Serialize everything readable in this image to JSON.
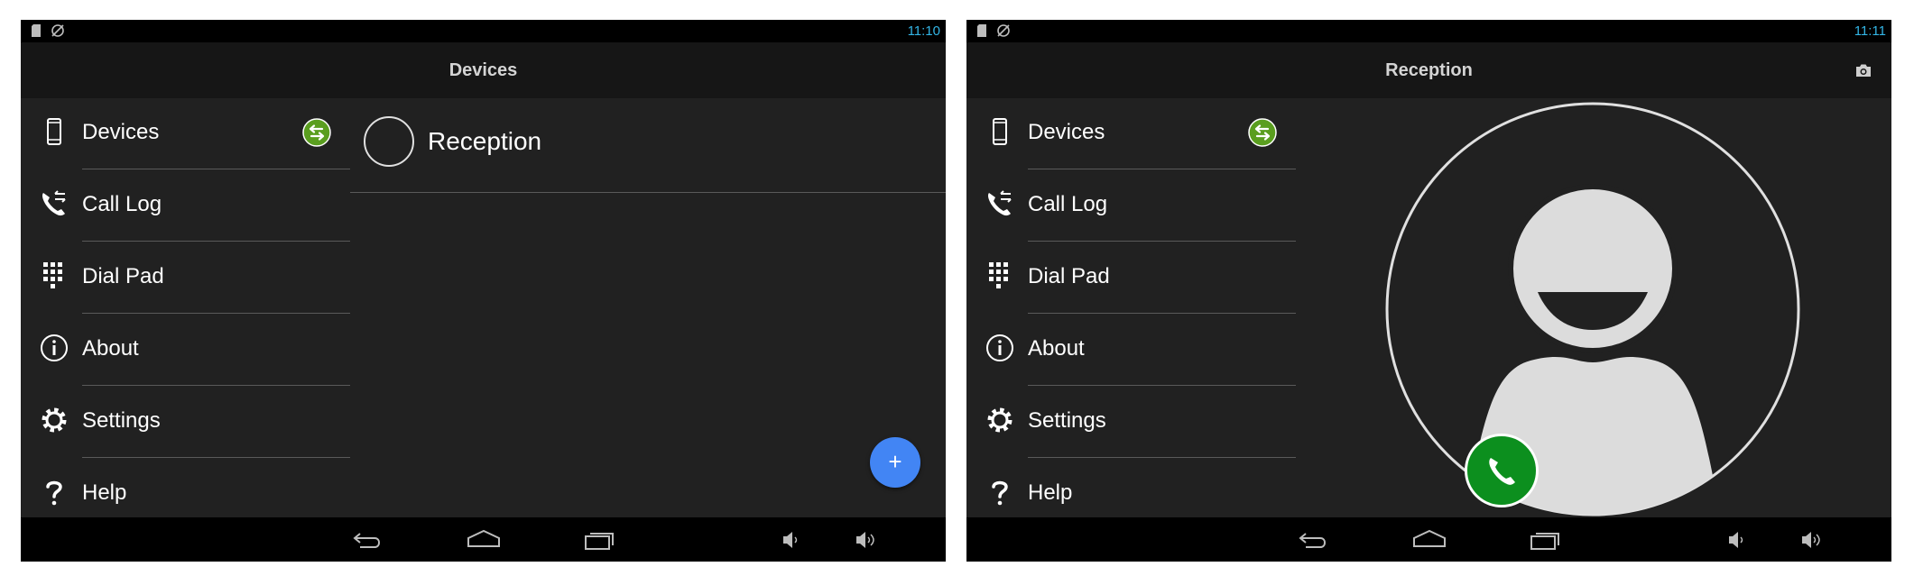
{
  "status_bar": {
    "time_left": "11:10",
    "time_right": "11:11"
  },
  "screen_left": {
    "title": "Devices",
    "device_list": [
      {
        "name": "Reception"
      }
    ],
    "fab_label": "+"
  },
  "screen_right": {
    "title": "Reception"
  },
  "drawer": {
    "items": [
      {
        "label": "Devices",
        "icon": "phone-icon"
      },
      {
        "label": "Call Log",
        "icon": "call-log-icon"
      },
      {
        "label": "Dial Pad",
        "icon": "dialpad-icon"
      },
      {
        "label": "About",
        "icon": "info-icon"
      },
      {
        "label": "Settings",
        "icon": "gear-icon"
      },
      {
        "label": "Help",
        "icon": "help-icon"
      }
    ]
  },
  "colors": {
    "clock": "#33b5e5",
    "sync_badge": "#5a9e1f",
    "fab": "#4285f4",
    "call_button": "#0c8f1e",
    "background": "#212121"
  }
}
